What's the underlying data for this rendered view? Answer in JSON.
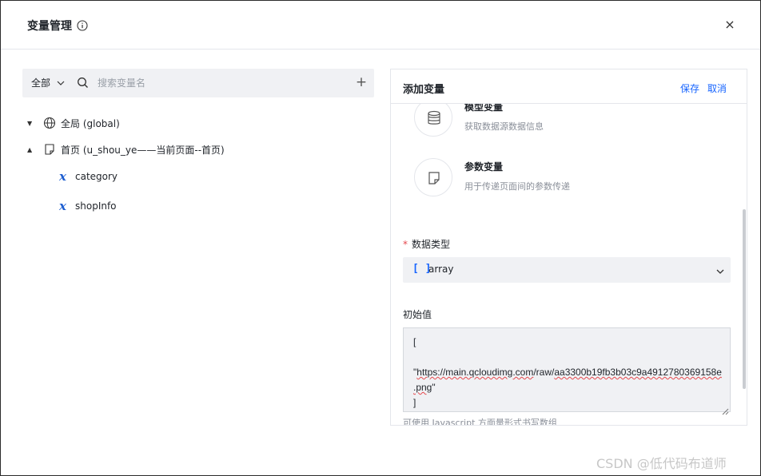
{
  "dialog": {
    "title": "变量管理",
    "close_symbol": "×"
  },
  "left": {
    "scope_label": "全部",
    "search_placeholder": "搜索变量名",
    "add_symbol": "+",
    "tree": [
      {
        "label": "全局 (global)",
        "icon": "globe-icon",
        "expanded": false
      },
      {
        "label": "首页 (u_shou_ye——当前页面--首页)",
        "icon": "page-icon",
        "expanded": true,
        "children": [
          {
            "label": "category",
            "icon": "variable-x-icon"
          },
          {
            "label": "shopInfo",
            "icon": "variable-x-icon"
          }
        ]
      }
    ]
  },
  "right": {
    "title": "添加变量",
    "save_label": "保存",
    "cancel_label": "取消",
    "types": [
      {
        "name": "模型变量",
        "desc": "获取数据源数据信息",
        "icon": "database-icon"
      },
      {
        "name": "参数变量",
        "desc": "用于传递页面间的参数传递",
        "icon": "param-page-icon"
      }
    ],
    "data_type_label": "数据类型",
    "required_mark": "*",
    "data_type_icon": "[ ]",
    "data_type_value": "array",
    "initial_value_label": "初始值",
    "initial_value_lines": {
      "l1": "[",
      "l2_prefix": "\"",
      "l2_link1": "https://main.qcloudimg.com",
      "l2_mid": "/raw/",
      "l2_link2": "aa3300b19fb3b03c9a4912780369158e",
      "l3_link": ".png",
      "l3_suffix": "\"",
      "l4": "]"
    },
    "hint": "可使用 Javascript 方面量形式书写数组"
  },
  "watermark": "CSDN @低代码布道师",
  "colors": {
    "accent": "#1664ff",
    "required": "#e5484d",
    "variable_icon": "#1f5fd1"
  }
}
